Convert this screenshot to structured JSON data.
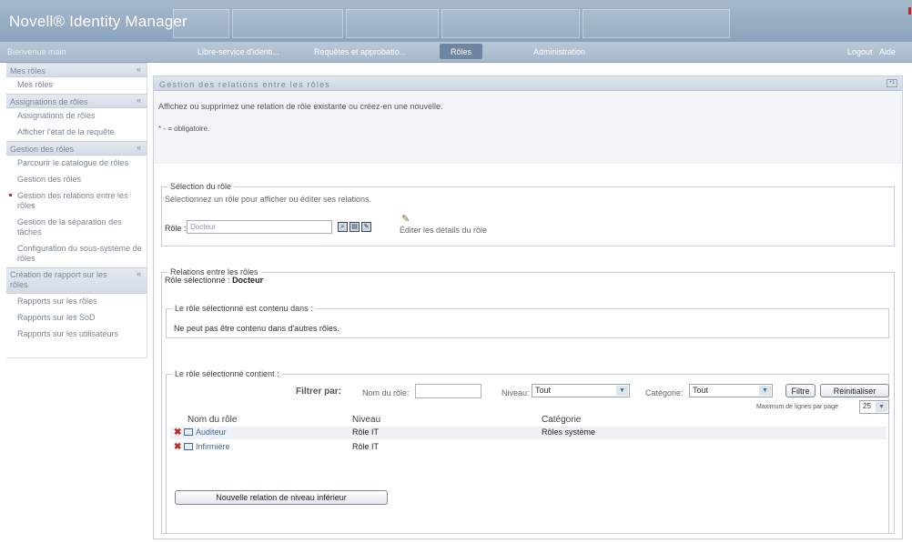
{
  "app": {
    "title": "Novell® Identity Manager"
  },
  "nav": {
    "welcome": "Bienvenue main",
    "tabs": [
      "Libre-service d'identi...",
      "Requêtes et approbatio...",
      "Rôles",
      "Administration"
    ],
    "active_tab": "Rôles",
    "logout": "Logout",
    "help": "Aide"
  },
  "sidebar": {
    "sections": [
      {
        "title": "Mes rôles",
        "items": [
          "Mes rôles"
        ]
      },
      {
        "title": "Assignations de rôles",
        "items": [
          "Assignations de rôles",
          "Afficher l'état de la requête"
        ]
      },
      {
        "title": "Gestion des rôles",
        "items": [
          "Parcourir le catalogue de rôles",
          "Gestion des rôles",
          "Gestion des relations entre les rôles",
          "Gestion de la séparation des tâches",
          "Configuration du sous-système de rôles"
        ]
      },
      {
        "title": "Création de rapport sur les rôles",
        "items": [
          "Rapports sur les rôles",
          "Rapports sur les SoD",
          "Rapports sur les utilisateurs"
        ]
      }
    ],
    "current_item": "Gestion des relations entre les rôles"
  },
  "panel": {
    "title": "Gestion des relations entre les rôles",
    "description": "Affichez ou supprimez une relation de rôle existante ou créez-en une nouvelle.",
    "required_note": "* - = obligatoire."
  },
  "role_selection": {
    "legend": "Sélection du rôle",
    "hint": "Sélectionnez un rôle pour afficher ou éditer ses relations.",
    "role_label": "Rôle :",
    "role_value": "Docteur",
    "edit_details": "Éditer les détails du rôle"
  },
  "relations": {
    "legend": "Relations entre les rôles",
    "selected_label": "Rôle sélectionné :",
    "selected_value": "Docteur",
    "contained_in": {
      "legend": "Le rôle sélectionné est contenu dans :",
      "message": "Ne peut pas être contenu dans d'autres rôles."
    },
    "contains": {
      "legend": "Le rôle sélectionné contient :",
      "filter_by": "Filtrer par:",
      "role_name_label": "Nom du rôle:",
      "level_label": "Niveau:",
      "level_value": "Tout",
      "category_label": "Catégorie:",
      "category_value": "Tout",
      "filter_button": "Filtre",
      "reset_button": "Réinitialiser",
      "max_rows_label": "Maximum de lignes par page",
      "max_rows_value": "25",
      "columns": [
        "Nom du rôle",
        "Niveau",
        "Catégorie"
      ],
      "rows": [
        {
          "name": "Auditeur",
          "level": "Rôle IT",
          "category": "Rôles système"
        },
        {
          "name": "Infirmière",
          "level": "Rôle IT",
          "category": ""
        }
      ],
      "new_relation_button": "Nouvelle relation de niveau inférieur"
    }
  },
  "colors": {
    "header": "#8aa3bc",
    "active_tab": "#6e86a2",
    "delete": "#c62020",
    "link": "#3d6aa0"
  }
}
